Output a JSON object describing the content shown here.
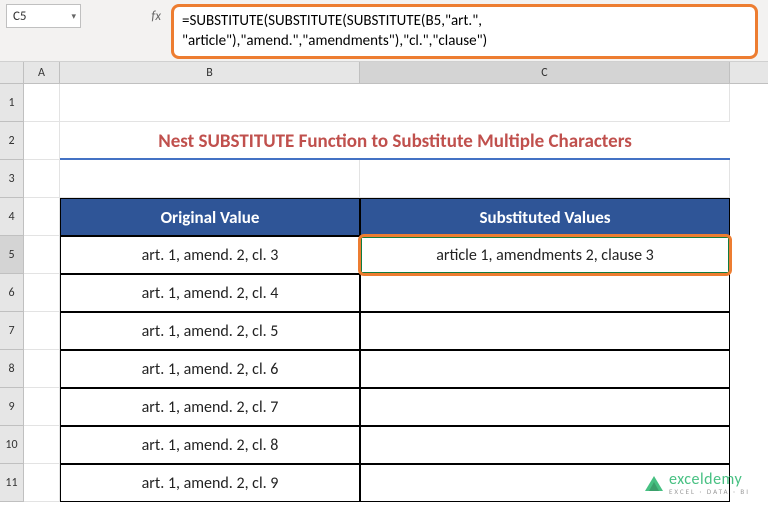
{
  "namebox": {
    "value": "C5"
  },
  "fx": {
    "label": "fx"
  },
  "formula": {
    "line1": "=SUBSTITUTE(SUBSTITUTE(SUBSTITUTE(B5,\"art.\",",
    "line2": "\"article\"),\"amend.\",\"amendments\"),\"cl.\",\"clause\")"
  },
  "columns": {
    "A": "A",
    "B": "B",
    "C": "C"
  },
  "rows": [
    "1",
    "2",
    "3",
    "4",
    "5",
    "6",
    "7",
    "8",
    "9",
    "10",
    "11"
  ],
  "title": "Nest SUBSTITUTE Function to Substitute Multiple Characters",
  "headers": {
    "original": "Original Value",
    "substituted": "Substituted Values"
  },
  "data": {
    "original": [
      "art. 1, amend. 2, cl. 3",
      "art. 1, amend. 2, cl. 4",
      "art. 1, amend. 2, cl. 5",
      "art. 1, amend. 2, cl. 6",
      "art. 1, amend. 2, cl. 7",
      "art. 1, amend. 2, cl. 8",
      "art. 1, amend. 2, cl. 9"
    ],
    "substituted": [
      "article 1, amendments 2, clause 3",
      "",
      "",
      "",
      "",
      "",
      ""
    ]
  },
  "watermark": {
    "main": "exceldemy",
    "sub": "EXCEL · DATA · BI"
  }
}
